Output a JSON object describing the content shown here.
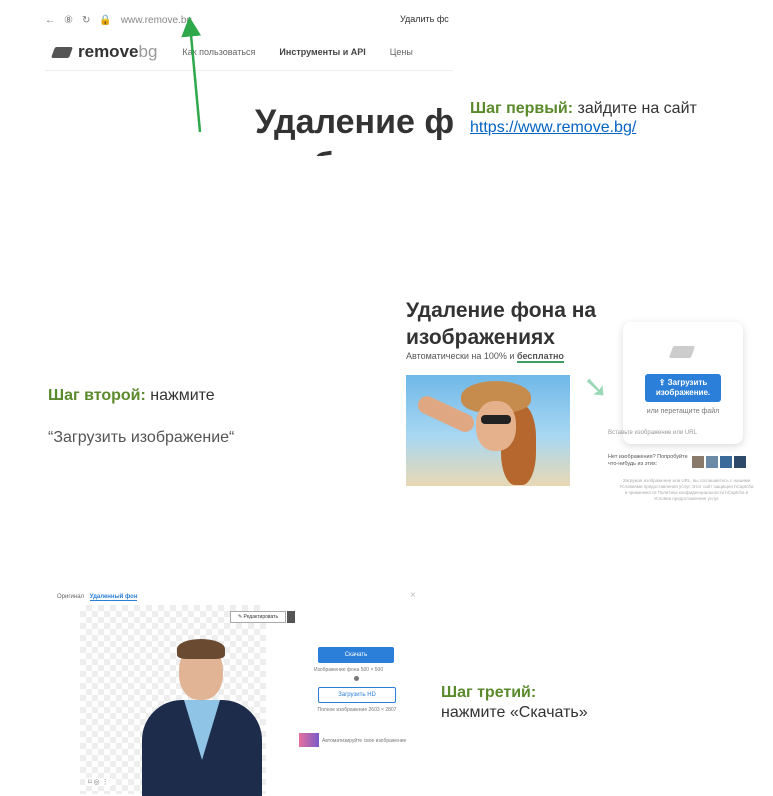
{
  "step1": {
    "browser": {
      "back": "←",
      "forward": "⑧",
      "reload": "↻",
      "url": "www.remove.bg",
      "tab_title": "Удалить фс"
    },
    "logo": {
      "main": "remove",
      "suffix": "bg"
    },
    "nav": [
      "Как пользоваться",
      "Инструменты и API",
      "Цены"
    ],
    "heading_line1": "Удаление фс",
    "heading_line2": "изображени",
    "caption": {
      "label": "Шаг первый:",
      "text": "зайдите на сайт",
      "link": "https://www.remove.bg/"
    }
  },
  "step2": {
    "heading": "Удаление фона на изображениях",
    "heading_line1": "Удаление фона на",
    "heading_line2": "изображениях",
    "subtitle_prefix": "Автоматически на 100% и",
    "subtitle_bold": "бесплатно",
    "upload_button_line1": "⇪ Загрузить",
    "upload_button_line2": "изображение.",
    "drop_text": "или перетащите файл",
    "paste_text": "Вставьте изображение или URL",
    "no_image_text": "Нет изображения? Попробуйте что-нибудь из этих:",
    "fine_print": "Загружая изображение или URL, вы соглашаетесь с нашими Условиями предоставления услуг. Этот сайт защищен hCaptcha и применяются Политика конфиденциальности hCaptcha и Условия предоставления услуг.",
    "caption_label": "Шаг второй:",
    "caption_text": "нажмите",
    "caption_line2": "“Загрузить изображение“"
  },
  "step3": {
    "tab_original": "Оригинал",
    "tab_removed": "Удаленный фон",
    "close": "×",
    "edit_button": "✎ Редактировать",
    "tools": "⌑  ◎  ⋮",
    "download_button": "Скачать",
    "preview_text": "Изображение фона 500 × 500",
    "hd_button": "Загрузить HD",
    "full_text": "Полное изображение 2603 × 2807",
    "auto_text": "Автоматизируйте свое изображение",
    "caption_label": "Шаг третий:",
    "caption_text": "нажмите «Скачать»"
  },
  "colors": {
    "accent_green": "#5a8a2b",
    "link_blue": "#0563c1",
    "button_blue": "#2b7fd8",
    "arrow_green": "#2ea84a"
  }
}
